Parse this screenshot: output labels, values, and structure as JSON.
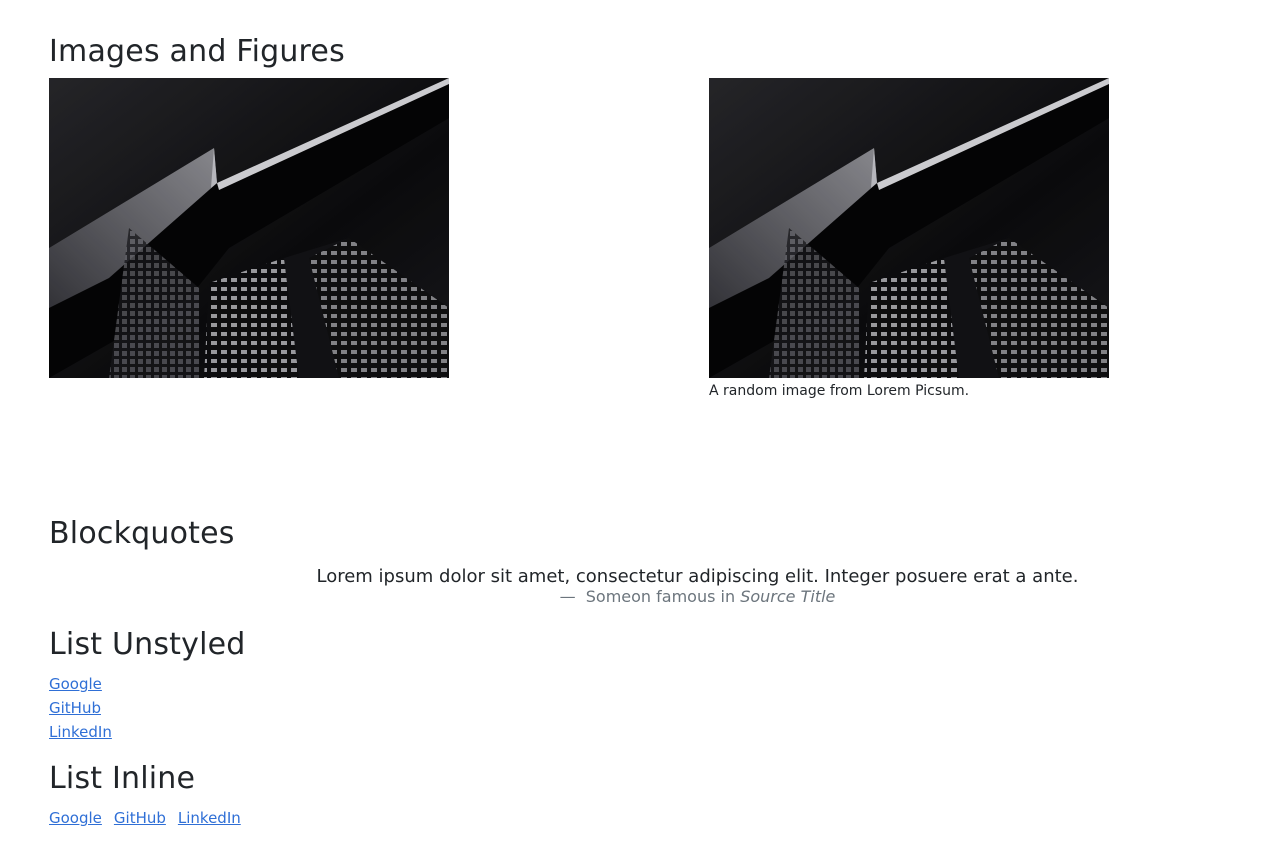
{
  "sections": {
    "images_title": "Images and Figures",
    "blockquotes_title": "Blockquotes",
    "list_unstyled_title": "List Unstyled",
    "list_inline_title": "List Inline"
  },
  "figure": {
    "caption": "A random image from Lorem Picsum."
  },
  "blockquote": {
    "text": "Lorem ipsum dolor sit amet, consectetur adipiscing elit. Integer posuere erat a ante.",
    "dash": "—",
    "attribution": "Someon famous in",
    "source": "Source Title"
  },
  "unstyled_links": [
    "Google",
    "GitHub",
    "LinkedIn"
  ],
  "inline_links": [
    "Google",
    "GitHub",
    "LinkedIn"
  ],
  "colors": {
    "text": "#212529",
    "muted": "#6c757d",
    "link": "#2f6fd6"
  }
}
